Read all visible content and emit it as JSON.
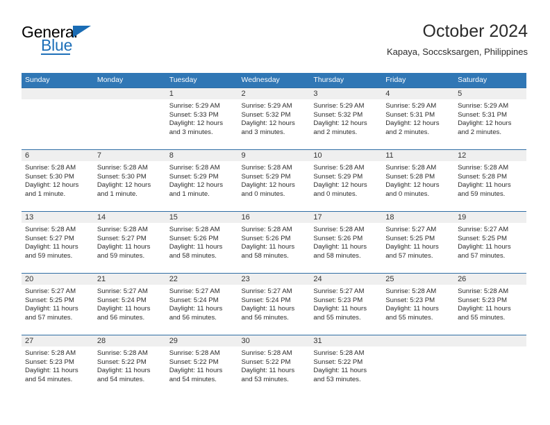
{
  "brand": {
    "name_top": "General",
    "name_bottom": "Blue",
    "accent_color": "#1d6fb8"
  },
  "header": {
    "title": "October 2024",
    "subtitle": "Kapaya, Soccsksargen, Philippines"
  },
  "calendar": {
    "header_bg": "#3077b5",
    "daynum_bg": "#efefef",
    "weekdays": [
      "Sunday",
      "Monday",
      "Tuesday",
      "Wednesday",
      "Thursday",
      "Friday",
      "Saturday"
    ],
    "weeks": [
      [
        {
          "day": "",
          "lines": []
        },
        {
          "day": "",
          "lines": []
        },
        {
          "day": "1",
          "lines": [
            "Sunrise: 5:29 AM",
            "Sunset: 5:33 PM",
            "Daylight: 12 hours",
            "and 3 minutes."
          ]
        },
        {
          "day": "2",
          "lines": [
            "Sunrise: 5:29 AM",
            "Sunset: 5:32 PM",
            "Daylight: 12 hours",
            "and 3 minutes."
          ]
        },
        {
          "day": "3",
          "lines": [
            "Sunrise: 5:29 AM",
            "Sunset: 5:32 PM",
            "Daylight: 12 hours",
            "and 2 minutes."
          ]
        },
        {
          "day": "4",
          "lines": [
            "Sunrise: 5:29 AM",
            "Sunset: 5:31 PM",
            "Daylight: 12 hours",
            "and 2 minutes."
          ]
        },
        {
          "day": "5",
          "lines": [
            "Sunrise: 5:29 AM",
            "Sunset: 5:31 PM",
            "Daylight: 12 hours",
            "and 2 minutes."
          ]
        }
      ],
      [
        {
          "day": "6",
          "lines": [
            "Sunrise: 5:28 AM",
            "Sunset: 5:30 PM",
            "Daylight: 12 hours",
            "and 1 minute."
          ]
        },
        {
          "day": "7",
          "lines": [
            "Sunrise: 5:28 AM",
            "Sunset: 5:30 PM",
            "Daylight: 12 hours",
            "and 1 minute."
          ]
        },
        {
          "day": "8",
          "lines": [
            "Sunrise: 5:28 AM",
            "Sunset: 5:29 PM",
            "Daylight: 12 hours",
            "and 1 minute."
          ]
        },
        {
          "day": "9",
          "lines": [
            "Sunrise: 5:28 AM",
            "Sunset: 5:29 PM",
            "Daylight: 12 hours",
            "and 0 minutes."
          ]
        },
        {
          "day": "10",
          "lines": [
            "Sunrise: 5:28 AM",
            "Sunset: 5:29 PM",
            "Daylight: 12 hours",
            "and 0 minutes."
          ]
        },
        {
          "day": "11",
          "lines": [
            "Sunrise: 5:28 AM",
            "Sunset: 5:28 PM",
            "Daylight: 12 hours",
            "and 0 minutes."
          ]
        },
        {
          "day": "12",
          "lines": [
            "Sunrise: 5:28 AM",
            "Sunset: 5:28 PM",
            "Daylight: 11 hours",
            "and 59 minutes."
          ]
        }
      ],
      [
        {
          "day": "13",
          "lines": [
            "Sunrise: 5:28 AM",
            "Sunset: 5:27 PM",
            "Daylight: 11 hours",
            "and 59 minutes."
          ]
        },
        {
          "day": "14",
          "lines": [
            "Sunrise: 5:28 AM",
            "Sunset: 5:27 PM",
            "Daylight: 11 hours",
            "and 59 minutes."
          ]
        },
        {
          "day": "15",
          "lines": [
            "Sunrise: 5:28 AM",
            "Sunset: 5:26 PM",
            "Daylight: 11 hours",
            "and 58 minutes."
          ]
        },
        {
          "day": "16",
          "lines": [
            "Sunrise: 5:28 AM",
            "Sunset: 5:26 PM",
            "Daylight: 11 hours",
            "and 58 minutes."
          ]
        },
        {
          "day": "17",
          "lines": [
            "Sunrise: 5:28 AM",
            "Sunset: 5:26 PM",
            "Daylight: 11 hours",
            "and 58 minutes."
          ]
        },
        {
          "day": "18",
          "lines": [
            "Sunrise: 5:27 AM",
            "Sunset: 5:25 PM",
            "Daylight: 11 hours",
            "and 57 minutes."
          ]
        },
        {
          "day": "19",
          "lines": [
            "Sunrise: 5:27 AM",
            "Sunset: 5:25 PM",
            "Daylight: 11 hours",
            "and 57 minutes."
          ]
        }
      ],
      [
        {
          "day": "20",
          "lines": [
            "Sunrise: 5:27 AM",
            "Sunset: 5:25 PM",
            "Daylight: 11 hours",
            "and 57 minutes."
          ]
        },
        {
          "day": "21",
          "lines": [
            "Sunrise: 5:27 AM",
            "Sunset: 5:24 PM",
            "Daylight: 11 hours",
            "and 56 minutes."
          ]
        },
        {
          "day": "22",
          "lines": [
            "Sunrise: 5:27 AM",
            "Sunset: 5:24 PM",
            "Daylight: 11 hours",
            "and 56 minutes."
          ]
        },
        {
          "day": "23",
          "lines": [
            "Sunrise: 5:27 AM",
            "Sunset: 5:24 PM",
            "Daylight: 11 hours",
            "and 56 minutes."
          ]
        },
        {
          "day": "24",
          "lines": [
            "Sunrise: 5:27 AM",
            "Sunset: 5:23 PM",
            "Daylight: 11 hours",
            "and 55 minutes."
          ]
        },
        {
          "day": "25",
          "lines": [
            "Sunrise: 5:28 AM",
            "Sunset: 5:23 PM",
            "Daylight: 11 hours",
            "and 55 minutes."
          ]
        },
        {
          "day": "26",
          "lines": [
            "Sunrise: 5:28 AM",
            "Sunset: 5:23 PM",
            "Daylight: 11 hours",
            "and 55 minutes."
          ]
        }
      ],
      [
        {
          "day": "27",
          "lines": [
            "Sunrise: 5:28 AM",
            "Sunset: 5:23 PM",
            "Daylight: 11 hours",
            "and 54 minutes."
          ]
        },
        {
          "day": "28",
          "lines": [
            "Sunrise: 5:28 AM",
            "Sunset: 5:22 PM",
            "Daylight: 11 hours",
            "and 54 minutes."
          ]
        },
        {
          "day": "29",
          "lines": [
            "Sunrise: 5:28 AM",
            "Sunset: 5:22 PM",
            "Daylight: 11 hours",
            "and 54 minutes."
          ]
        },
        {
          "day": "30",
          "lines": [
            "Sunrise: 5:28 AM",
            "Sunset: 5:22 PM",
            "Daylight: 11 hours",
            "and 53 minutes."
          ]
        },
        {
          "day": "31",
          "lines": [
            "Sunrise: 5:28 AM",
            "Sunset: 5:22 PM",
            "Daylight: 11 hours",
            "and 53 minutes."
          ]
        },
        {
          "day": "",
          "lines": []
        },
        {
          "day": "",
          "lines": []
        }
      ]
    ]
  }
}
